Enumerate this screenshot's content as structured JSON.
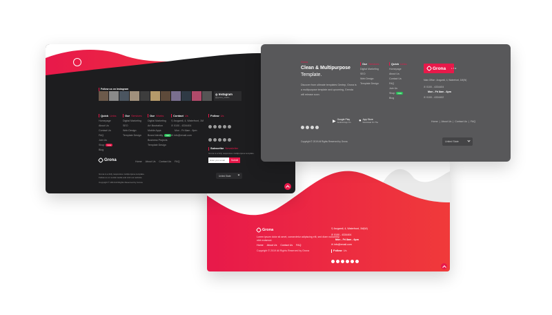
{
  "colors": {
    "accent": "#e8194a",
    "dark_bg": "#1d1d1f",
    "grey_bg": "#58585a",
    "red_gradient_end": "#f03a3a"
  },
  "brand": {
    "name": "Grona",
    "tag": "LTD"
  },
  "dark_card": {
    "instagram_heading": "Follow us on Instagram",
    "instagram_button": "Instagram",
    "instagram_handle": "@grona_studio",
    "columns": [
      {
        "title": "Quick",
        "accent": "Links",
        "items": [
          "Homepage",
          "About Us",
          "Contact Us",
          "FAQ",
          "Join Us",
          "Shop",
          "Blog"
        ],
        "badge_index": 5,
        "badge": "new"
      },
      {
        "title": "Our",
        "accent": "Services",
        "items": [
          "Digital Marketing",
          "SEO",
          "Web Design",
          "Template Design"
        ]
      },
      {
        "title": "Our",
        "accent": "Works",
        "items": [
          "Digital Marketing",
          "Art Illustration",
          "Mobile Apps",
          "Brand Identity",
          "Business Projects",
          "Template Design"
        ],
        "badge_index": 3,
        "badge": "new"
      },
      {
        "title": "Contact",
        "accent": "Us",
        "items": [
          "Arzgamli, 4, Waterfront, 1M",
          "0100 - 4334404",
          "Mon - Fri 8am - 6pm",
          "info@email.com"
        ]
      }
    ],
    "follow_title": "Follow",
    "follow_accent": "Us",
    "subscribe_title": "Subscribe",
    "subscribe_accent": "Newsletter",
    "email_placeholder": "Enter your email",
    "subscribe_button": "Submit",
    "about_text_1": "Grona is a fully responsive multipurpose template.",
    "about_text_2": "Follow us on social media and visit our website.",
    "links": [
      "Home",
      "About Us",
      "Contact Us",
      "FAQ"
    ],
    "copyright": "Copyright © 2019 All Rights Reserved by Grona",
    "select_value": "United State"
  },
  "grey_card": {
    "kicker": "Grona",
    "headline_1": "Clean & Multipurpose",
    "headline_2": "Template.",
    "desc_1": "Discover from ultimate templates Gentep, Grona is",
    "desc_2": "a multipurpose template and upcoming, Grenda",
    "desc_3": "will release soon.",
    "services_title": "Our",
    "services_accent": "Services",
    "services": [
      "Digital Marketing",
      "SEO",
      "Web Design",
      "Template Design"
    ],
    "links_title": "Quick",
    "links_accent": "Links",
    "links": [
      "Homepage",
      "About Us",
      "Contact Us",
      "FAQ",
      "Join Us",
      "Shop",
      "Blog"
    ],
    "shop_badge": "new",
    "address": "Main Office : Arzgamli, 4, Waterfront, 1M(W)",
    "phone": "0100 - 4334404",
    "hours": "Mon - Fri 8am - 6pm",
    "phone2": "0100 - 4334402",
    "google_play_top": "Google Play",
    "google_play_sub": "Android App On",
    "app_store_top": "App Store",
    "app_store_sub": "Download On The",
    "bottom_links": [
      "Home",
      "About Us",
      "Contact Us",
      "FAQ"
    ],
    "copyright": "Copyright © 2019 All Rights Reserved by Grona",
    "select_value": "United State"
  },
  "red_card": {
    "about_1": "Lorem ipsum dolor sit amet, consectetur adipiscing elit, sed diam nonummy",
    "about_2": "nibh euismod.",
    "links": [
      "Home",
      "About Us",
      "Contact Us",
      "FAQ"
    ],
    "copyright": "Copyright © 2019 All Rights Reserved by Grona",
    "address": "Arzgamli, 4, Waterfront, 1M(W)",
    "phone": "0100 - 4334404",
    "hours": "Mon - Fri 8am - 6pm",
    "email": "info@email.com",
    "follow_title": "Follow",
    "follow_accent": "Us"
  }
}
